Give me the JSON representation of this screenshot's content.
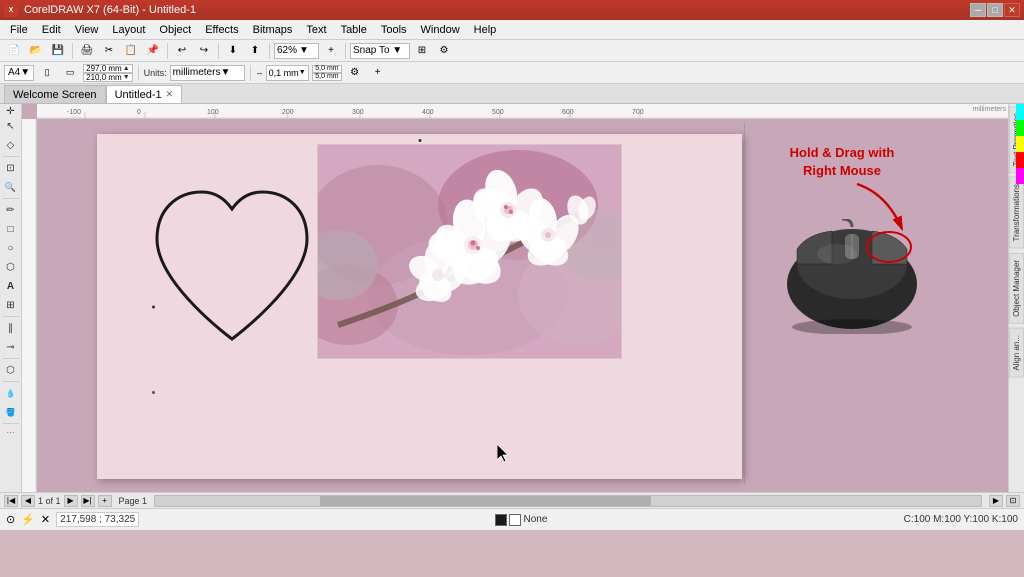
{
  "titleBar": {
    "title": "CorelDRAW X7 (64-Bit) - Untitled-1",
    "controls": [
      "minimize",
      "maximize",
      "close"
    ]
  },
  "menuBar": {
    "items": [
      "File",
      "Edit",
      "View",
      "Layout",
      "Object",
      "Effects",
      "Bitmaps",
      "Text",
      "Table",
      "Tools",
      "Window",
      "Help"
    ]
  },
  "toolbar1": {
    "zoomLevel": "62%",
    "snapTo": "Snap To ▼"
  },
  "toolbar2": {
    "paperSize": "A4",
    "width": "297,0 mm",
    "height": "210,0 mm",
    "units": "millimeters",
    "nudge": "0,1 mm",
    "nudgeH": "5,0 mm",
    "nudgeV": "5,0 mm"
  },
  "tabs": [
    {
      "label": "Welcome Screen",
      "active": false,
      "closable": false
    },
    {
      "label": "Untitled-1",
      "active": true,
      "closable": true
    }
  ],
  "tools": [
    {
      "name": "pick-tool",
      "symbol": "↖",
      "tooltip": "Pick Tool"
    },
    {
      "name": "node-tool",
      "symbol": "◇",
      "tooltip": "Node Tool"
    },
    {
      "name": "crop-tool",
      "symbol": "⊡",
      "tooltip": "Crop Tool"
    },
    {
      "name": "zoom-tool",
      "symbol": "🔍",
      "tooltip": "Zoom Tool"
    },
    {
      "name": "freehand-tool",
      "symbol": "✏",
      "tooltip": "Freehand Tool"
    },
    {
      "name": "rect-tool",
      "symbol": "□",
      "tooltip": "Rectangle Tool"
    },
    {
      "name": "ellipse-tool",
      "symbol": "○",
      "tooltip": "Ellipse Tool"
    },
    {
      "name": "polygon-tool",
      "symbol": "⬡",
      "tooltip": "Polygon Tool"
    },
    {
      "name": "text-tool",
      "symbol": "A",
      "tooltip": "Text Tool"
    },
    {
      "name": "table-tool",
      "symbol": "⊞",
      "tooltip": "Table Tool"
    },
    {
      "name": "parallel-tool",
      "symbol": "∥",
      "tooltip": "Parallel Dimension Tool"
    },
    {
      "name": "connector-tool",
      "symbol": "⟋",
      "tooltip": "Connector Tool"
    },
    {
      "name": "blend-tool",
      "symbol": "⬡",
      "tooltip": "Blend Tool"
    },
    {
      "name": "eyedropper-tool",
      "symbol": "💧",
      "tooltip": "Eyedropper Tool"
    },
    {
      "name": "fill-tool",
      "symbol": "🪣",
      "tooltip": "Fill Tool"
    }
  ],
  "rightPanel": {
    "panels": [
      "Text Properties",
      "Transformations",
      "Object Manager",
      "Align an..."
    ]
  },
  "canvas": {
    "bgColor": "#c8a8b8",
    "pageColor": "#f0d8e0",
    "heartText": "",
    "mouseInstruction": "Hold & Drag with\nRight Mouse"
  },
  "colorPalette": {
    "colors": [
      "#ff0000",
      "#ff8800",
      "#ffff00",
      "#00cc00",
      "#00ffff",
      "#0000ff",
      "#8800cc",
      "#ff00ff",
      "#ffffff",
      "#cccccc",
      "#888888",
      "#000000",
      "#cc0000",
      "#884400",
      "#ccaa00",
      "#006600",
      "#004488",
      "#000088",
      "#440088",
      "#880044",
      "#f0f0f0",
      "#d0d0d0",
      "#a0a0a0",
      "#404040"
    ]
  },
  "statusBar": {
    "coordinates": "217,598 ; 73,325",
    "fillColor": "None",
    "colorProfile": "C:100 M:100 Y:100 K:100",
    "pageInfo": "1 of 1",
    "pageName": "Page 1"
  }
}
